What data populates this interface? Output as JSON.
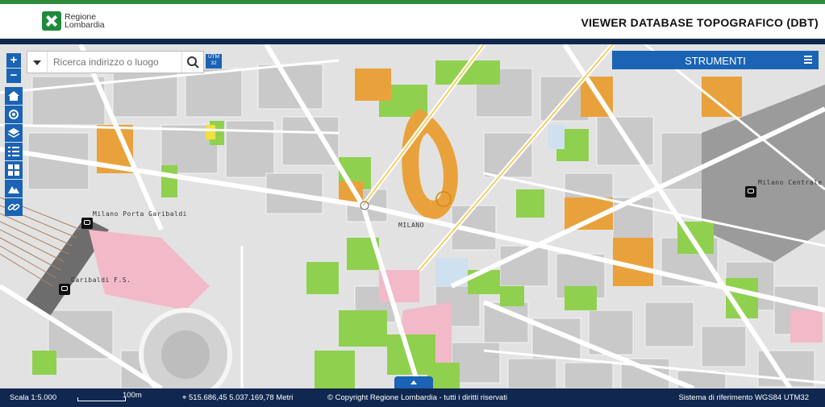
{
  "header": {
    "logo_text": "Regione Lombardia",
    "logo_line1": "Regione",
    "logo_line2": "Lombardia",
    "title": "VIEWER DATABASE TOPOGRAFICO (DBT)"
  },
  "map_controls": {
    "zoom_in": "+",
    "zoom_out": "−",
    "tools": [
      "home-icon",
      "locate-icon",
      "layers-icon",
      "list-icon",
      "grid-icon",
      "terrain-icon",
      "link-icon"
    ]
  },
  "search": {
    "placeholder": "Ricerca indirizzo o luogo",
    "utm_badge": "UTM 32"
  },
  "tools_panel": {
    "label": "STRUMENTI"
  },
  "map_labels": {
    "milano_porta_garibaldi": "Milano Porta Garibaldi",
    "garibaldi_fs": "Garibaldi F.S.",
    "milano": "MILANO",
    "milano_centrale": "Milano Centrale"
  },
  "statusbar": {
    "scale": "Scala 1:5.000",
    "scalebar_label": "100m",
    "coordinates": "515.686,45 5.037.169,78 Metri",
    "copyright": "© Copyright Regione Lombardia - tutti i diritti riservati",
    "crs": "Sistema di riferimento WGS84 UTM32"
  },
  "colors": {
    "brand_green": "#2e8b3a",
    "navy": "#10284f",
    "accent_blue": "#1a63b5",
    "park_green": "#8fd14f",
    "orange": "#e9a23b",
    "pink": "#e88aa8"
  }
}
